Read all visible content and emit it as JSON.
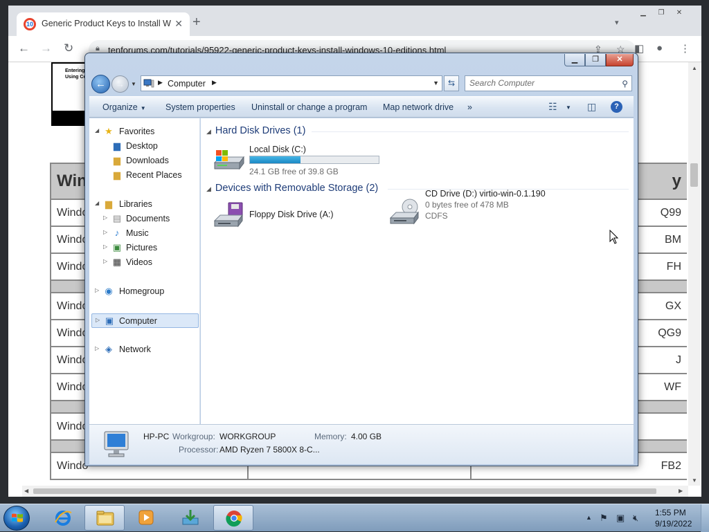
{
  "browser": {
    "tab_title": "Generic Product Keys to Install W",
    "tab_close": "✕",
    "new_tab": "+",
    "url": "tenforums.com/tutorials/95922-generic-product-keys-install-windows-10-editions.html",
    "favicon_text": "10"
  },
  "page": {
    "image_text_1": "Entering",
    "image_text_2": "Using Co",
    "table_header_left": "Win",
    "table_header_right": "y",
    "rows": [
      {
        "left": "Windo",
        "right": "Q99"
      },
      {
        "left": "Windo",
        "right": "BM"
      },
      {
        "left": "Windo",
        "right": "FH"
      },
      {
        "gap": true
      },
      {
        "left": "Windo",
        "right": "GX"
      },
      {
        "left": "Windo",
        "right": "QG9"
      },
      {
        "left": "Windo",
        "right": "J"
      },
      {
        "left": "Windo",
        "right": "WF"
      },
      {
        "gap": true
      },
      {
        "left": "Windo",
        "right": ""
      },
      {
        "gap": true
      },
      {
        "left": "Windo",
        "right": "FB2"
      }
    ]
  },
  "explorer": {
    "address": {
      "location": "Computer"
    },
    "search": {
      "placeholder": "Search Computer"
    },
    "commands": {
      "organize": "Organize",
      "system_properties": "System properties",
      "uninstall": "Uninstall or change a program",
      "map_drive": "Map network drive",
      "more": "»"
    },
    "nav": {
      "favorites": "Favorites",
      "desktop": "Desktop",
      "downloads": "Downloads",
      "recent_places": "Recent Places",
      "libraries": "Libraries",
      "documents": "Documents",
      "music": "Music",
      "pictures": "Pictures",
      "videos": "Videos",
      "homegroup": "Homegroup",
      "computer": "Computer",
      "network": "Network"
    },
    "groups": {
      "hard_disk": "Hard Disk Drives (1)",
      "removable": "Devices with Removable Storage (2)"
    },
    "drives": {
      "local_disk": {
        "name": "Local Disk (C:)",
        "free": "24.1 GB free of 39.8 GB",
        "used_fraction": 0.394
      },
      "floppy": {
        "name": "Floppy Disk Drive (A:)"
      },
      "cd": {
        "name": "CD Drive (D:) virtio-win-0.1.190",
        "free": "0 bytes free of 478 MB",
        "fs": "CDFS"
      }
    },
    "details": {
      "pc_name": "HP-PC",
      "workgroup_label": "Workgroup:",
      "workgroup": "WORKGROUP",
      "memory_label": "Memory:",
      "memory": "4.00 GB",
      "processor_label": "Processor:",
      "processor": "AMD Ryzen 7 5800X 8-C..."
    }
  },
  "taskbar": {
    "time": "1:55 PM",
    "date": "9/19/2022"
  },
  "colors": {
    "accent": "#1c88c4",
    "selection": "#dbe8f8",
    "group_header": "#1e3c78"
  }
}
